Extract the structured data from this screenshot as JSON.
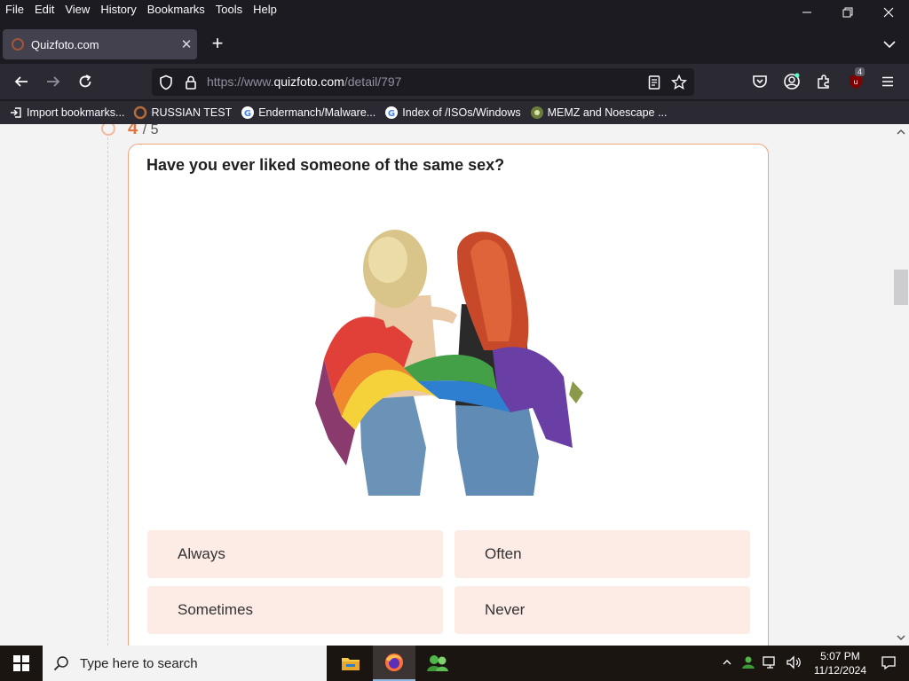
{
  "menubar": {
    "items": [
      "File",
      "Edit",
      "View",
      "History",
      "Bookmarks",
      "Tools",
      "Help"
    ]
  },
  "tab": {
    "title": "Quizfoto.com"
  },
  "navbar": {
    "url_prefix": "https://www.",
    "url_host": "quizfoto.com",
    "url_path": "/detail/797",
    "extension_badge": "4"
  },
  "bookmarks": [
    {
      "label": "Import bookmarks...",
      "icon": "import-icon"
    },
    {
      "label": "RUSSIAN TEST",
      "icon": "site-icon"
    },
    {
      "label": "Endermanch/Malware...",
      "icon": "google-icon"
    },
    {
      "label": "Index of /ISOs/Windows",
      "icon": "google-icon"
    },
    {
      "label": "MEMZ and Noescape ...",
      "icon": "site-icon"
    }
  ],
  "quiz": {
    "progress_current": "4",
    "progress_total": "/ 5",
    "question": "Have you ever liked someone of the same sex?",
    "answers": [
      "Always",
      "Often",
      "Sometimes",
      "Never"
    ]
  },
  "taskbar": {
    "search_placeholder": "Type here to search",
    "time": "5:07 PM",
    "date": "11/12/2024"
  },
  "colors": {
    "accent": "#e07642",
    "answer_bg": "#fdece5",
    "card_border": "#f2a57b"
  }
}
